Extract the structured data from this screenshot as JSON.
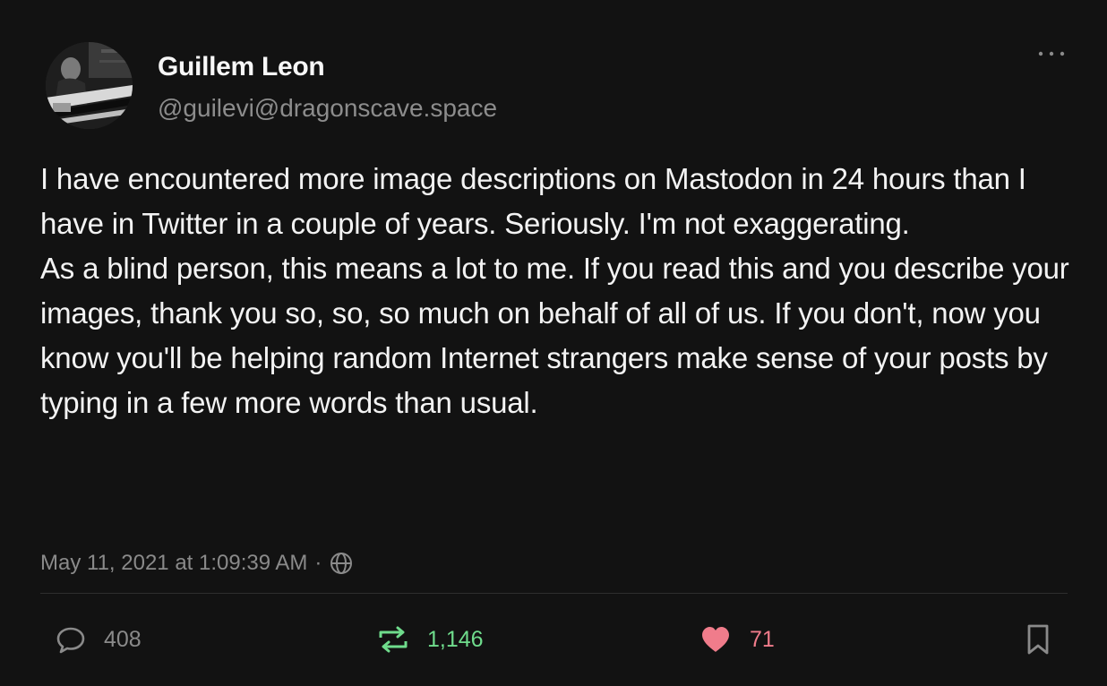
{
  "author": {
    "display_name": "Guillem Leon",
    "handle": "@guilevi@dragonscave.space",
    "avatar_icon": "avatar"
  },
  "post": {
    "paragraphs": [
      "I have encountered more image descriptions on Mastodon in 24 hours than I have in Twitter in a couple of years. Seriously. I'm not exaggerating.",
      "As a blind person, this means a lot to me. If you read this and you describe your images, thank you so, so, so much on behalf of all of us. If you don't, now you know you'll be helping random Internet strangers make sense of your posts by typing in a few more words than usual."
    ],
    "timestamp": "May 11, 2021 at 1:09:39 AM",
    "separator": "·",
    "visibility_icon": "globe-icon"
  },
  "actions": {
    "reply": {
      "icon": "reply-icon",
      "count": "408",
      "color": "#8a8a8a"
    },
    "boost": {
      "icon": "boost-icon",
      "count": "1,146",
      "color": "#6fdc8c"
    },
    "like": {
      "icon": "heart-icon",
      "count": "71",
      "color": "#f07c8b"
    },
    "bookmark": {
      "icon": "bookmark-icon"
    },
    "more": {
      "icon": "more-icon"
    }
  },
  "theme": {
    "background": "#121212",
    "text": "#f3f3f3",
    "muted": "#8a8a8a"
  }
}
